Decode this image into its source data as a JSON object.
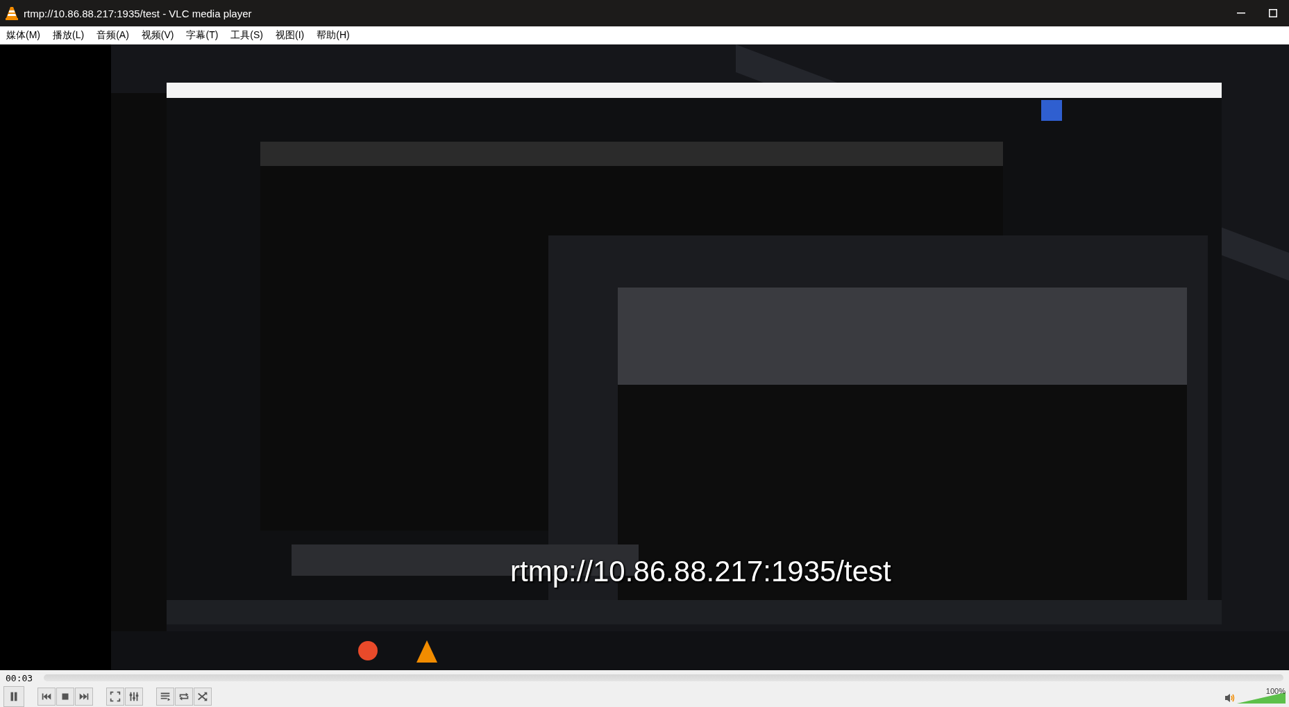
{
  "window": {
    "title": "rtmp://10.86.88.217:1935/test - VLC media player"
  },
  "menu": [
    "媒体(M)",
    "播放(L)",
    "音频(A)",
    "视频(V)",
    "字幕(T)",
    "工具(S)",
    "视图(I)",
    "帮助(H)"
  ],
  "video": {
    "kind": "picture",
    "osd_title": "rtmp://10.86.88.217:1935/test"
  },
  "playback": {
    "time": "00:03",
    "playing": true
  },
  "controls": [
    {
      "kind": "pause"
    },
    {
      "kind": "previous"
    },
    {
      "kind": "stop"
    },
    {
      "kind": "next"
    },
    {
      "kind": "fullscreen"
    },
    {
      "kind": "equalizer"
    },
    {
      "kind": "playlist"
    },
    {
      "kind": "loop"
    },
    {
      "kind": "shuffle"
    }
  ],
  "volume": {
    "level": 1,
    "reading": "100%"
  }
}
